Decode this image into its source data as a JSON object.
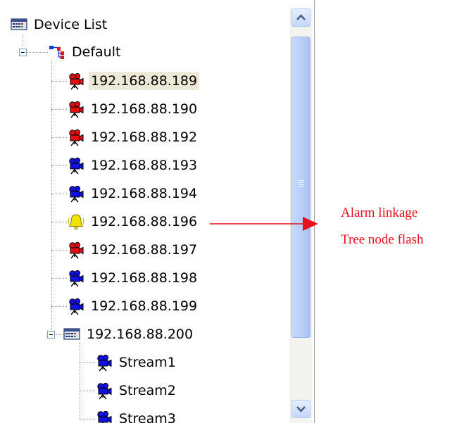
{
  "tree": {
    "root": {
      "label": "Device List",
      "icon": "device-list-icon"
    },
    "group": {
      "label": "Default",
      "icon": "network-group-icon",
      "expanded": true
    },
    "devices": [
      {
        "label": "192.168.88.189",
        "icon": "camera-icon",
        "color": "#e01010",
        "selected": true
      },
      {
        "label": "192.168.88.190",
        "icon": "camera-icon",
        "color": "#e01010"
      },
      {
        "label": "192.168.88.192",
        "icon": "camera-icon",
        "color": "#e01010"
      },
      {
        "label": "192.168.88.193",
        "icon": "camera-icon",
        "color": "#1010e0"
      },
      {
        "label": "192.168.88.194",
        "icon": "camera-icon",
        "color": "#1010e0"
      },
      {
        "label": "192.168.88.196",
        "icon": "alarm-bell-icon",
        "color": "#f2e200"
      },
      {
        "label": "192.168.88.197",
        "icon": "camera-icon",
        "color": "#e01010"
      },
      {
        "label": "192.168.88.198",
        "icon": "camera-icon",
        "color": "#1010e0"
      },
      {
        "label": "192.168.88.199",
        "icon": "camera-icon",
        "color": "#1010e0"
      }
    ],
    "nvr": {
      "label": "192.168.88.200",
      "icon": "nvr-icon",
      "expanded": true
    },
    "streams": [
      {
        "label": "Stream1",
        "icon": "camera-icon",
        "color": "#1010e0"
      },
      {
        "label": "Stream2",
        "icon": "camera-icon",
        "color": "#1010e0"
      },
      {
        "label": "Stream3",
        "icon": "camera-icon",
        "color": "#1010e0"
      }
    ]
  },
  "scrollbar": {
    "up_icon": "chevron-up-icon",
    "down_icon": "chevron-down-icon",
    "grip_icon": "grip-icon"
  },
  "annotation": {
    "line1": "Alarm linkage",
    "line2": "Tree node flash",
    "color": "#e8101c"
  }
}
